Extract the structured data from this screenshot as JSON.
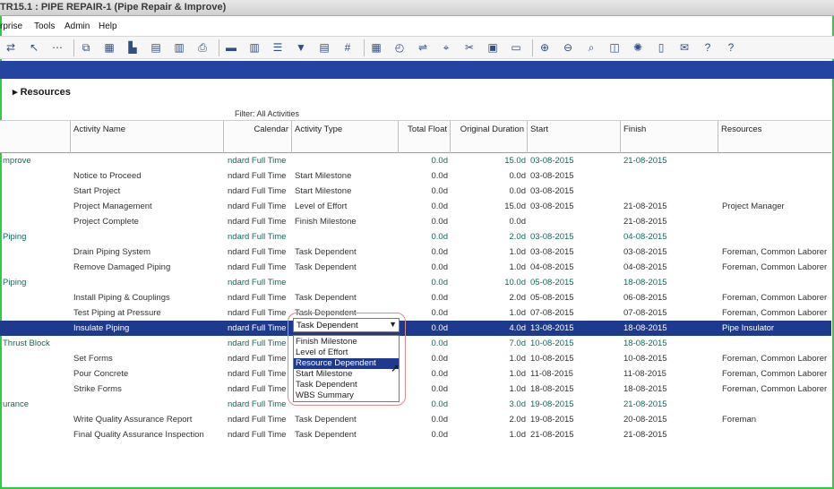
{
  "window": {
    "title": "TR15.1 : PIPE REPAIR-1 (Pipe Repair & Improve)"
  },
  "menu": [
    "rprise",
    "Tools",
    "Admin",
    "Help"
  ],
  "toolbar": {
    "icons": [
      "filter-icon",
      "link-icon",
      "more-icon",
      "copy-icon",
      "table-icon",
      "chart-icon",
      "gantt-icon",
      "histogram-icon",
      "printer-icon",
      "bars-icon",
      "columns-icon",
      "list-icon",
      "funnel-icon",
      "group-icon",
      "number-icon",
      "calendar-icon",
      "clock-icon",
      "network-icon",
      "assign-icon",
      "scissors-icon",
      "layout-icon",
      "window-icon",
      "zoom-in-icon",
      "zoom-out-icon",
      "zoom-fit-icon",
      "split-icon",
      "settings-icon",
      "panel-icon",
      "comment-icon",
      "help-icon",
      "help2-icon"
    ],
    "glyphs": [
      "⇄",
      "↖",
      "⋯",
      "⧉",
      "▦",
      "▙",
      "▤",
      "▥",
      "⎙",
      "▬",
      "▥",
      "☰",
      "▼",
      "▤",
      "#",
      "▦",
      "◴",
      "⇌",
      "⌖",
      "✂",
      "▣",
      "▭",
      "⊕",
      "⊖",
      "⌕",
      "◫",
      "✺",
      "▯",
      "✉",
      "?",
      "?"
    ]
  },
  "section": {
    "title": "Resources"
  },
  "filter": {
    "label": "Filter: All Activities"
  },
  "columns": [
    "Activity Name",
    "Calendar",
    "Activity Type",
    "Total Float",
    "Original Duration",
    "Start",
    "Finish",
    "Resources"
  ],
  "rows": [
    {
      "kind": "wbs",
      "name": "mprove",
      "calendar": "ndard Full Time",
      "type": "",
      "float": "0.0d",
      "dur": "15.0d",
      "start": "03-08-2015",
      "finish": "21-08-2015",
      "res": ""
    },
    {
      "kind": "act",
      "name": "Notice to Proceed",
      "calendar": "ndard Full Time",
      "type": "Start Milestone",
      "float": "0.0d",
      "dur": "0.0d",
      "start": "03-08-2015",
      "finish": "",
      "res": ""
    },
    {
      "kind": "act",
      "name": "Start Project",
      "calendar": "ndard Full Time",
      "type": "Start Milestone",
      "float": "0.0d",
      "dur": "0.0d",
      "start": "03-08-2015",
      "finish": "",
      "res": ""
    },
    {
      "kind": "act",
      "name": "Project Management",
      "calendar": "ndard Full Time",
      "type": "Level of Effort",
      "float": "0.0d",
      "dur": "15.0d",
      "start": "03-08-2015",
      "finish": "21-08-2015",
      "res": "Project Manager"
    },
    {
      "kind": "act",
      "name": "Project Complete",
      "calendar": "ndard Full Time",
      "type": "Finish Milestone",
      "float": "0.0d",
      "dur": "0.0d",
      "start": "",
      "finish": "21-08-2015",
      "res": ""
    },
    {
      "kind": "wbs",
      "name": "Piping",
      "calendar": "ndard Full Time",
      "type": "",
      "float": "0.0d",
      "dur": "2.0d",
      "start": "03-08-2015",
      "finish": "04-08-2015",
      "res": ""
    },
    {
      "kind": "act",
      "name": "Drain Piping System",
      "calendar": "ndard Full Time",
      "type": "Task Dependent",
      "float": "0.0d",
      "dur": "1.0d",
      "start": "03-08-2015",
      "finish": "03-08-2015",
      "res": "Foreman, Common Laborer"
    },
    {
      "kind": "act",
      "name": "Remove Damaged Piping",
      "calendar": "ndard Full Time",
      "type": "Task Dependent",
      "float": "0.0d",
      "dur": "1.0d",
      "start": "04-08-2015",
      "finish": "04-08-2015",
      "res": "Foreman, Common Laborer"
    },
    {
      "kind": "wbs",
      "name": "Piping",
      "calendar": "ndard Full Time",
      "type": "",
      "float": "0.0d",
      "dur": "10.0d",
      "start": "05-08-2015",
      "finish": "18-08-2015",
      "res": ""
    },
    {
      "kind": "act",
      "name": "Install Piping & Couplings",
      "calendar": "ndard Full Time",
      "type": "Task Dependent",
      "float": "0.0d",
      "dur": "2.0d",
      "start": "05-08-2015",
      "finish": "06-08-2015",
      "res": "Foreman, Common Laborer"
    },
    {
      "kind": "act",
      "name": "Test Piping at Pressure",
      "calendar": "ndard Full Time",
      "type": "Task Dependent",
      "float": "0.0d",
      "dur": "1.0d",
      "start": "07-08-2015",
      "finish": "07-08-2015",
      "res": "Foreman, Common Laborer"
    },
    {
      "kind": "selected",
      "name": "Insulate Piping",
      "calendar": "ndard Full Time",
      "type": "",
      "float": "0.0d",
      "dur": "4.0d",
      "start": "13-08-2015",
      "finish": "18-08-2015",
      "res": "Pipe Insulator"
    },
    {
      "kind": "wbs",
      "name": "Thrust Block",
      "calendar": "ndard Full Time",
      "type": "",
      "float": "0.0d",
      "dur": "7.0d",
      "start": "10-08-2015",
      "finish": "18-08-2015",
      "res": ""
    },
    {
      "kind": "act",
      "name": "Set Forms",
      "calendar": "ndard Full Time",
      "type": "",
      "float": "0.0d",
      "dur": "1.0d",
      "start": "10-08-2015",
      "finish": "10-08-2015",
      "res": "Foreman, Common Laborer"
    },
    {
      "kind": "act",
      "name": "Pour Concrete",
      "calendar": "ndard Full Time",
      "type": "",
      "float": "0.0d",
      "dur": "1.0d",
      "start": "11-08-2015",
      "finish": "11-08-2015",
      "res": "Foreman, Common Laborer"
    },
    {
      "kind": "act",
      "name": "Strike Forms",
      "calendar": "ndard Full Time",
      "type": "",
      "float": "0.0d",
      "dur": "1.0d",
      "start": "18-08-2015",
      "finish": "18-08-2015",
      "res": "Foreman, Common Laborer"
    },
    {
      "kind": "wbs",
      "name": "urance",
      "calendar": "ndard Full Time",
      "type": "",
      "float": "0.0d",
      "dur": "3.0d",
      "start": "19-08-2015",
      "finish": "21-08-2015",
      "res": ""
    },
    {
      "kind": "act",
      "name": "Write Quality Assurance Report",
      "calendar": "ndard Full Time",
      "type": "Task Dependent",
      "float": "0.0d",
      "dur": "2.0d",
      "start": "19-08-2015",
      "finish": "20-08-2015",
      "res": "Foreman"
    },
    {
      "kind": "act",
      "name": "Final Quality Assurance Inspection",
      "calendar": "ndard Full Time",
      "type": "Task Dependent",
      "float": "0.0d",
      "dur": "1.0d",
      "start": "21-08-2015",
      "finish": "21-08-2015",
      "res": ""
    }
  ],
  "dropdown": {
    "value": "Task Dependent",
    "options": [
      "Finish Milestone",
      "Level of Effort",
      "Resource Dependent",
      "Start Milestone",
      "Task Dependent",
      "WBS Summary"
    ],
    "highlighted": "Resource Dependent"
  },
  "colors": {
    "selection": "#1e3a8f",
    "band": "#2344a0",
    "wbs_text": "#0f6b5d",
    "frame": "#2ecc40"
  }
}
